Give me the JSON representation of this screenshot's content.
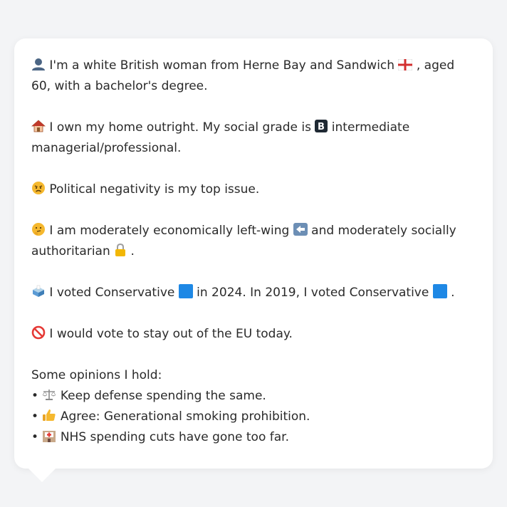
{
  "profile": {
    "identity": {
      "icon": "person-silhouette-icon",
      "text_before_flag": "I'm a white British woman from Herne Bay and Sandwich",
      "flag_icon": "england-flag-icon",
      "text_after_flag": ", aged 60, with a bachelor's degree."
    },
    "home": {
      "icon": "house-icon",
      "text_before_badge": "I own my home outright. My social grade is",
      "badge_icon": "letter-b-button-icon",
      "text_after_badge": "intermediate managerial/professional."
    },
    "issue": {
      "icon": "angry-face-icon",
      "text": "Political negativity is my top issue."
    },
    "ideology": {
      "icon": "thinking-face-icon",
      "text_before_left": "I am moderately economically left-wing",
      "left_icon": "left-arrow-icon",
      "text_middle": "and moderately socially authoritarian",
      "lock_icon": "lock-icon",
      "text_end": "."
    },
    "votes": {
      "icon": "ballot-box-icon",
      "text_1": "I voted Conservative",
      "square_icon_1": "blue-square-icon",
      "text_2": "in 2024. In 2019, I voted Conservative",
      "square_icon_2": "blue-square-icon",
      "text_3": "."
    },
    "eu": {
      "icon": "prohibited-icon",
      "text": "I would vote to stay out of the EU today."
    },
    "opinions": {
      "heading": "Some opinions I hold:",
      "items": [
        {
          "bullet": "•",
          "icon": "balance-scale-icon",
          "text": "Keep defense spending the same."
        },
        {
          "bullet": "•",
          "icon": "thumbs-up-icon",
          "text": "Agree: Generational smoking prohibition."
        },
        {
          "bullet": "•",
          "icon": "hospital-icon",
          "text": "NHS spending cuts have gone too far."
        }
      ]
    }
  },
  "colors": {
    "page_background": "#f3f4f6",
    "card_background": "#ffffff",
    "text": "#2a2a2a",
    "flag_red": "#d32f2f",
    "square_blue": "#1e88e5"
  }
}
